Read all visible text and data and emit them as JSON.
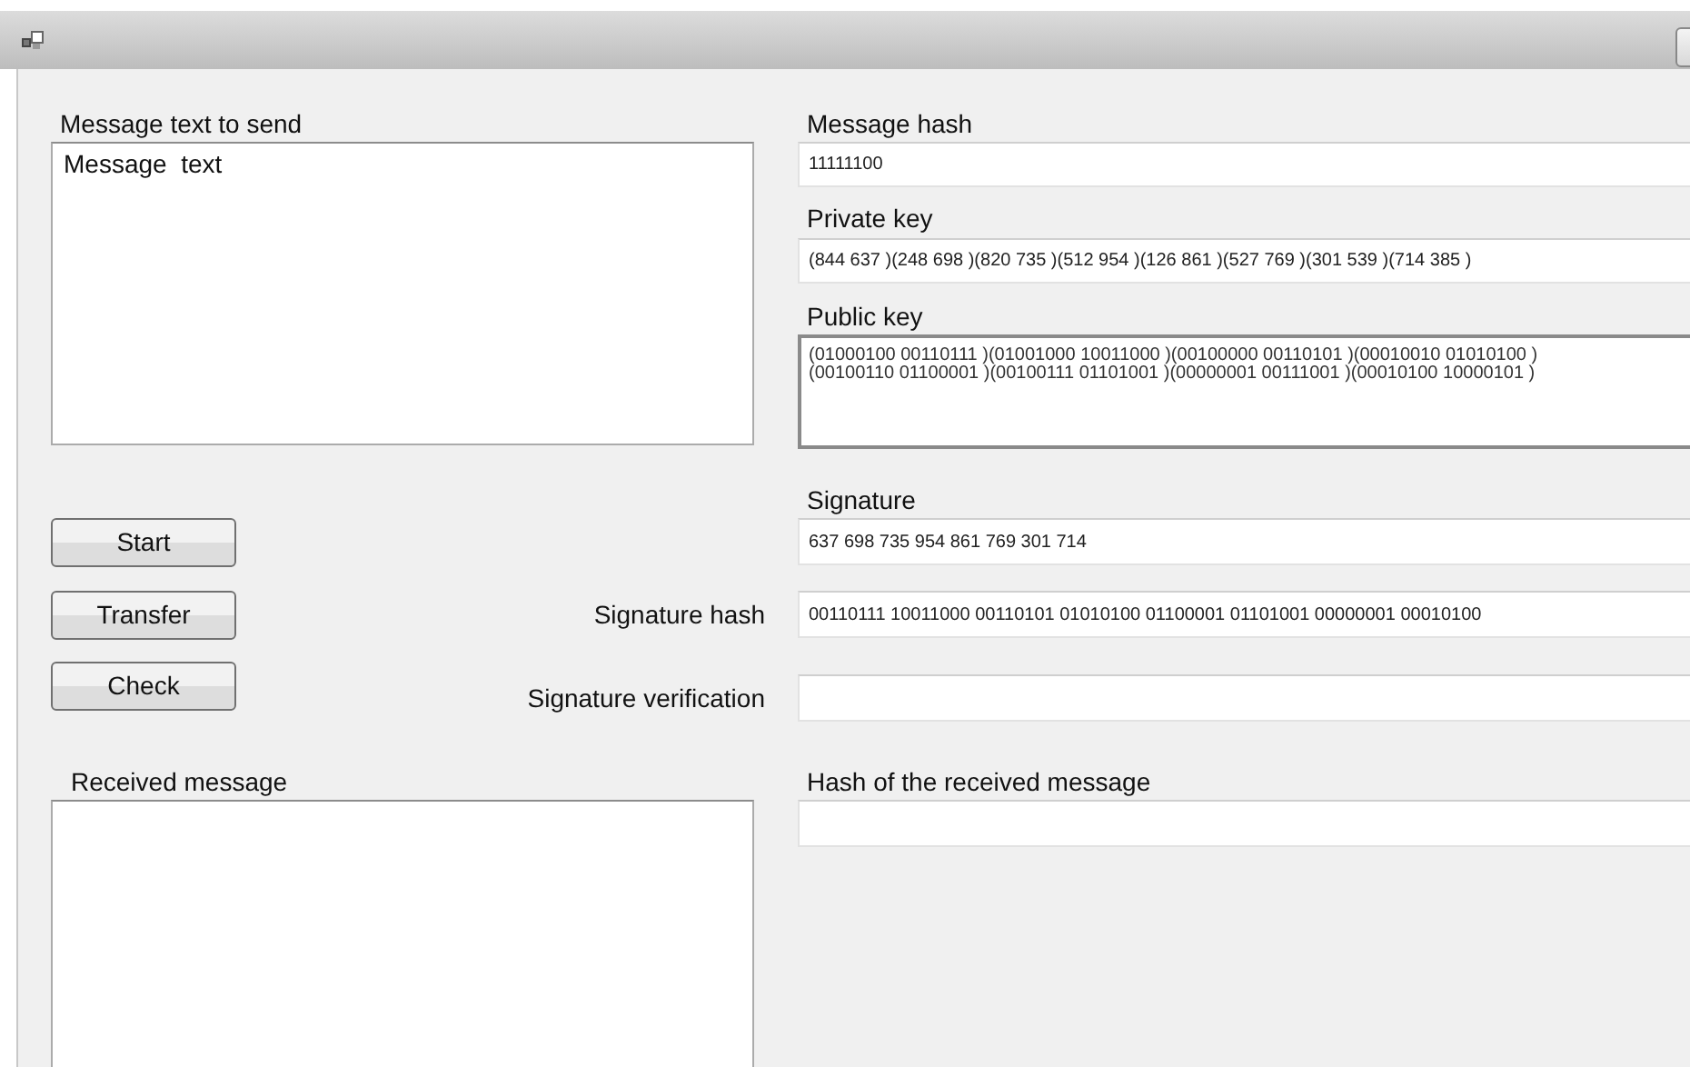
{
  "sender": {
    "label": "Message text to send",
    "text": "Message  text"
  },
  "message_hash": {
    "label": "Message hash",
    "value": "11111100"
  },
  "private_key": {
    "label": "Private key",
    "value": "(844 637 )(248 698 )(820 735 )(512 954 )(126 861 )(527 769 )(301 539 )(714 385 )"
  },
  "public_key": {
    "label": "Public key",
    "lines": [
      "(01000100 00110111 )(01001000 10011000 )(00100000 00110101 )(00010010 01010100 )",
      "(00100110 01100001 )(00100111 01101001 )(00000001 00111001 )(00010100 10000101 )"
    ]
  },
  "signature": {
    "label": "Signature",
    "value": "637 698 735 954 861 769 301 714"
  },
  "signature_hash": {
    "label": "Signature hash",
    "value": "00110111 10011000 00110101 01010100 01100001 01101001 00000001 00010100"
  },
  "signature_verification": {
    "label": "Signature verification"
  },
  "buttons": [
    "Start",
    "Transfer",
    "Check"
  ],
  "receiver": {
    "label": "Received message"
  },
  "received_hash": {
    "label": "Hash of the received message"
  }
}
